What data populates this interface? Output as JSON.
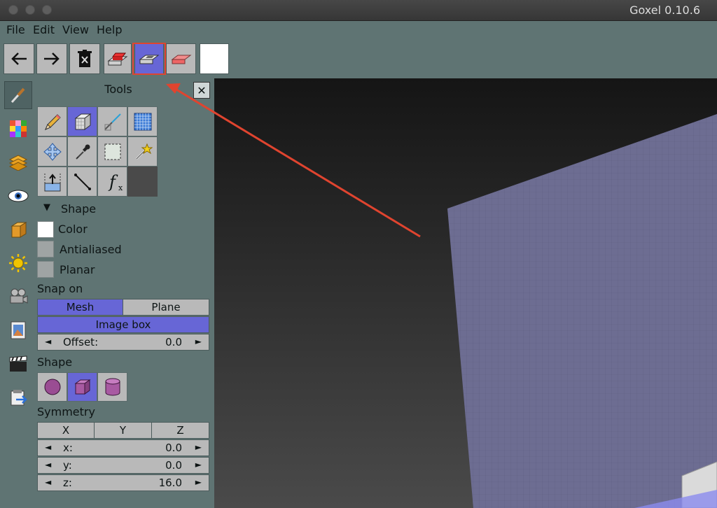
{
  "window": {
    "title": "Goxel 0.10.6"
  },
  "menu": [
    "File",
    "Edit",
    "View",
    "Help"
  ],
  "toolbar": {
    "buttons": [
      {
        "name": "undo",
        "icon": "arrow-left-icon"
      },
      {
        "name": "redo",
        "icon": "arrow-right-icon"
      },
      {
        "name": "delete",
        "icon": "trash-icon"
      },
      {
        "name": "mode-add",
        "icon": "add-mode-icon"
      },
      {
        "name": "mode-sub",
        "icon": "sub-mode-icon",
        "active": true
      },
      {
        "name": "mode-paint",
        "icon": "paint-mode-icon"
      }
    ],
    "color_swatch": "#ffffff"
  },
  "panel": {
    "title": "Tools",
    "shape_section": "Shape",
    "color_label": "Color",
    "antialiased_label": "Antialiased",
    "planar_label": "Planar",
    "snap_label": "Snap on",
    "snap_mesh": "Mesh",
    "snap_plane": "Plane",
    "snap_image_box": "Image box",
    "offset_label": "Offset:",
    "offset_value": "0.0",
    "shape_label": "Shape",
    "symmetry_label": "Symmetry",
    "sym_x": "X",
    "sym_y": "Y",
    "sym_z": "Z",
    "x_label": "x:",
    "x_value": "0.0",
    "y_label": "y:",
    "y_value": "0.0",
    "z_label": "z:",
    "z_value": "16.0",
    "left_arrow": "◄",
    "right_arrow": "►",
    "close": "✕",
    "expand_arrow": "▼",
    "fx": "f"
  },
  "colors": {
    "accent": "#6766d6",
    "annotation": "#e0442f",
    "panel": "#5f7473"
  }
}
